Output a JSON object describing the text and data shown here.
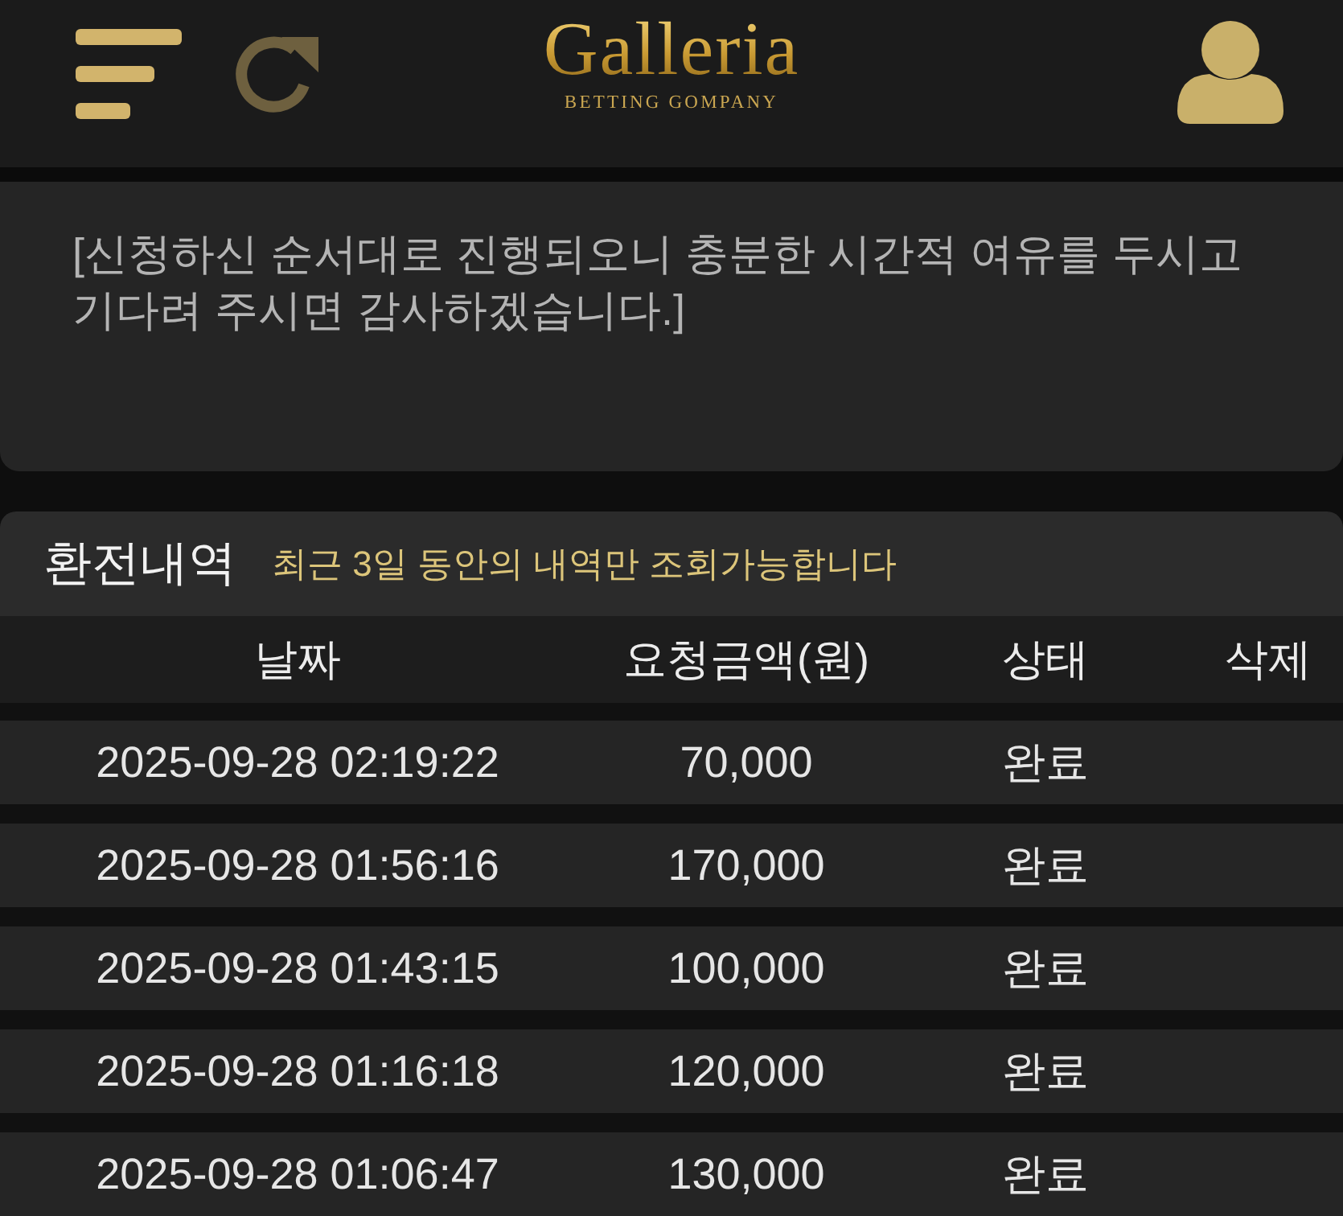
{
  "header": {
    "logo": {
      "title": "Galleria",
      "subtitle": "BETTING GOMPANY"
    }
  },
  "notice": {
    "text": "[신청하신 순서대로 진행되오니 충분한 시간적 여유를 두시고 기다려 주시면 감사하겠습니다.]"
  },
  "history": {
    "title": "환전내역",
    "subtitle": "최근 3일 동안의 내역만 조회가능합니다",
    "columns": [
      "날짜",
      "요청금액(원)",
      "상태",
      "삭제"
    ],
    "rows": [
      {
        "date": "2025-09-28 02:19:22",
        "amount": "70,000",
        "status": "완료"
      },
      {
        "date": "2025-09-28 01:56:16",
        "amount": "170,000",
        "status": "완료"
      },
      {
        "date": "2025-09-28 01:43:15",
        "amount": "100,000",
        "status": "완료"
      },
      {
        "date": "2025-09-28 01:16:18",
        "amount": "120,000",
        "status": "완료"
      },
      {
        "date": "2025-09-28 01:06:47",
        "amount": "130,000",
        "status": "완료"
      }
    ]
  }
}
